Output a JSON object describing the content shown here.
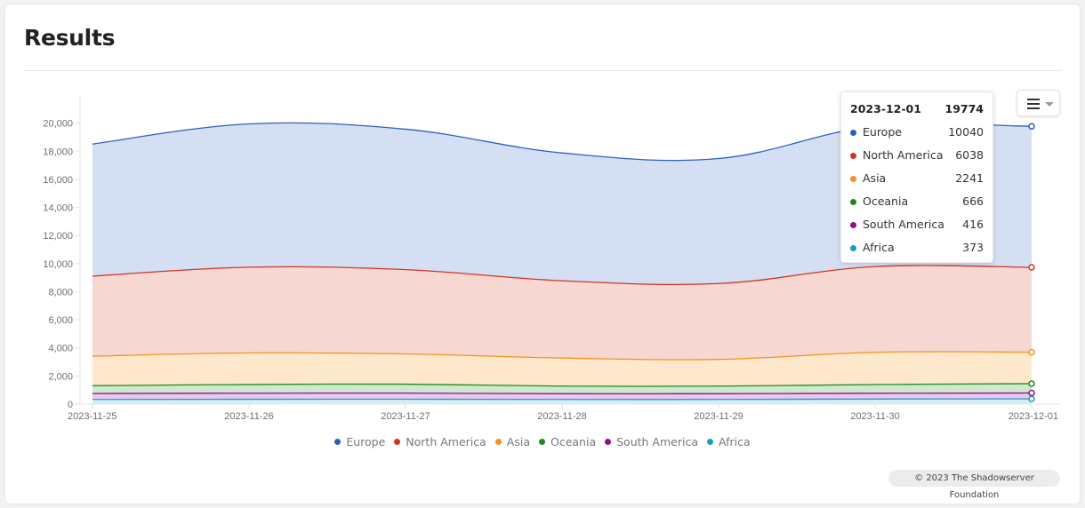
{
  "page": {
    "title": "Results",
    "menu_button": {
      "icon": "hamburger-icon",
      "caret_icon": "caret-down-icon"
    },
    "credit": "© 2023 The Shadowserver Foundation"
  },
  "tooltip": {
    "date": "2023-12-01",
    "total": "19774",
    "rows": [
      {
        "name": "Europe",
        "value": "10040",
        "color": "#2f5fbf"
      },
      {
        "name": "North America",
        "value": "6038",
        "color": "#d4341f"
      },
      {
        "name": "Asia",
        "value": "2241",
        "color": "#f5921e"
      },
      {
        "name": "Oceania",
        "value": "666",
        "color": "#1e8a1e"
      },
      {
        "name": "South America",
        "value": "416",
        "color": "#8e0e8e"
      },
      {
        "name": "Africa",
        "value": "373",
        "color": "#1b9cbf"
      }
    ]
  },
  "chart_data": {
    "type": "area",
    "stacked": true,
    "smoothed": true,
    "title": "",
    "xlabel": "",
    "ylabel": "",
    "categories": [
      "2023-11-25",
      "2023-11-26",
      "2023-11-27",
      "2023-11-28",
      "2023-11-29",
      "2023-11-30",
      "2023-12-01"
    ],
    "ylim": [
      0,
      22000
    ],
    "yticks": [
      0,
      2000,
      4000,
      6000,
      8000,
      10000,
      12000,
      14000,
      16000,
      18000,
      20000
    ],
    "ytick_labels": [
      "0",
      "2,000",
      "4,000",
      "6,000",
      "8,000",
      "10,000",
      "12,000",
      "14,000",
      "16,000",
      "18,000",
      "20,000"
    ],
    "grid": false,
    "legend_position": "bottom",
    "series": [
      {
        "name": "Africa",
        "color": "#1b9cbf",
        "fill": "#d3eef6",
        "values": [
          330,
          345,
          350,
          330,
          330,
          360,
          373
        ]
      },
      {
        "name": "South America",
        "color": "#8e0e8e",
        "fill": "#ebc8ee",
        "values": [
          420,
          430,
          430,
          410,
          410,
          410,
          416
        ]
      },
      {
        "name": "Oceania",
        "color": "#1e8a1e",
        "fill": "#cfe8cf",
        "values": [
          560,
          620,
          640,
          540,
          540,
          620,
          666
        ]
      },
      {
        "name": "Asia",
        "color": "#f5921e",
        "fill": "#fde8cb",
        "values": [
          2100,
          2250,
          2150,
          2000,
          1900,
          2300,
          2241
        ]
      },
      {
        "name": "North America",
        "color": "#d4341f",
        "fill": "#f7d7d2",
        "values": [
          5700,
          6100,
          6000,
          5500,
          5400,
          6100,
          6038
        ]
      },
      {
        "name": "Europe",
        "color": "#2f5fbf",
        "fill": "#d4dff4",
        "values": [
          9400,
          10200,
          10000,
          9100,
          8900,
          10000,
          10040
        ]
      }
    ],
    "legend_order": [
      "Europe",
      "North America",
      "Asia",
      "Oceania",
      "South America",
      "Africa"
    ]
  }
}
